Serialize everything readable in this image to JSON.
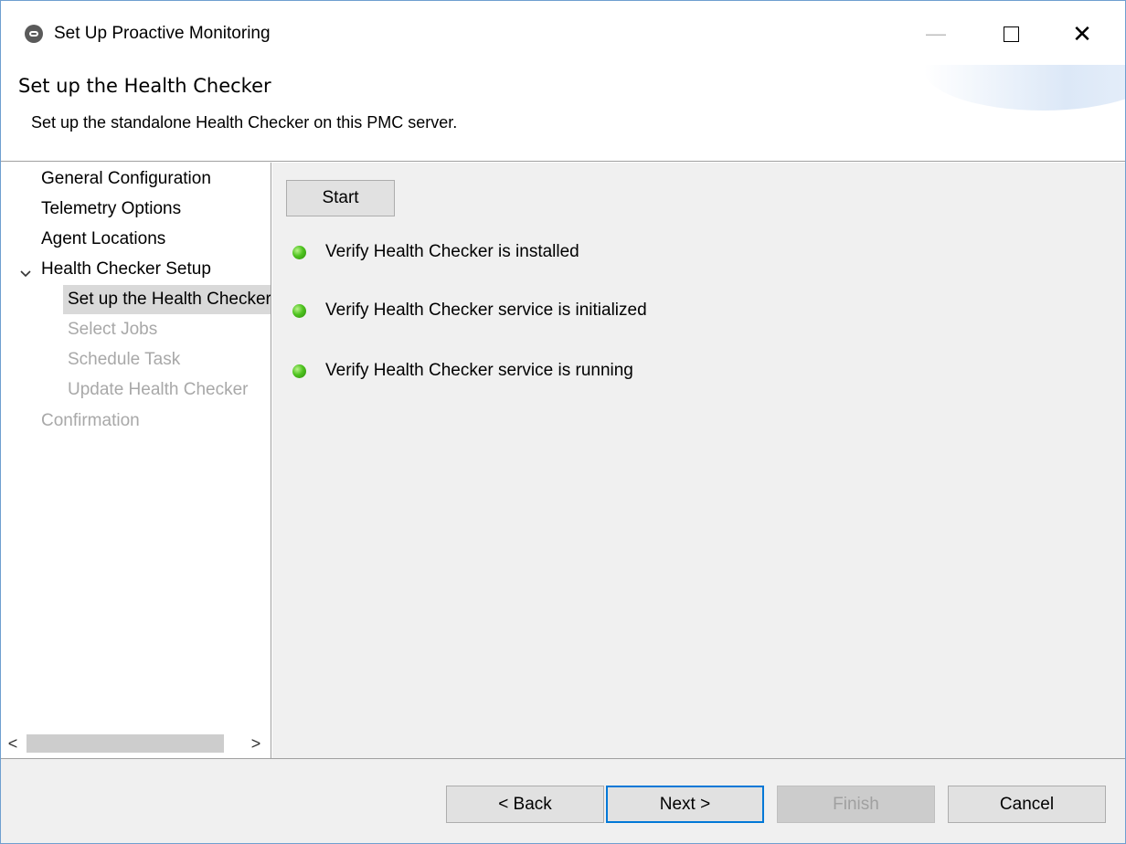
{
  "window": {
    "title": "Set Up Proactive Monitoring",
    "icon": "app-icon",
    "controls": {
      "minimize": "—",
      "maximize": "□",
      "close": "✕"
    }
  },
  "banner": {
    "title": "Set up the Health Checker",
    "description": "Set up the standalone Health Checker on this PMC server."
  },
  "nav": {
    "items": [
      {
        "label": "General Configuration",
        "state": "enabled"
      },
      {
        "label": "Telemetry Options",
        "state": "enabled"
      },
      {
        "label": "Agent Locations",
        "state": "enabled"
      },
      {
        "label": "Health Checker Setup",
        "state": "expanded"
      },
      {
        "label": "Set up the Health Checker",
        "state": "selected"
      },
      {
        "label": "Select Jobs",
        "state": "disabled"
      },
      {
        "label": "Schedule Task",
        "state": "disabled"
      },
      {
        "label": "Update Health Checker",
        "state": "disabled"
      },
      {
        "label": "Confirmation",
        "state": "disabled"
      }
    ],
    "scroll_left": "<",
    "scroll_right": ">"
  },
  "main": {
    "start_label": "Start",
    "checks": [
      {
        "label": "Verify Health Checker is installed",
        "status_color": "#4ec31f"
      },
      {
        "label": "Verify Health Checker service is initialized",
        "status_color": "#4ec31f"
      },
      {
        "label": "Verify Health Checker service is running",
        "status_color": "#4ec31f"
      }
    ]
  },
  "footer": {
    "back_label": "< Back",
    "next_label": "Next >",
    "finish_label": "Finish",
    "cancel_label": "Cancel"
  },
  "colors": {
    "accent": "#0078d7",
    "status_ok": "#4ec31f",
    "disabled_text": "#a8a8a8"
  }
}
